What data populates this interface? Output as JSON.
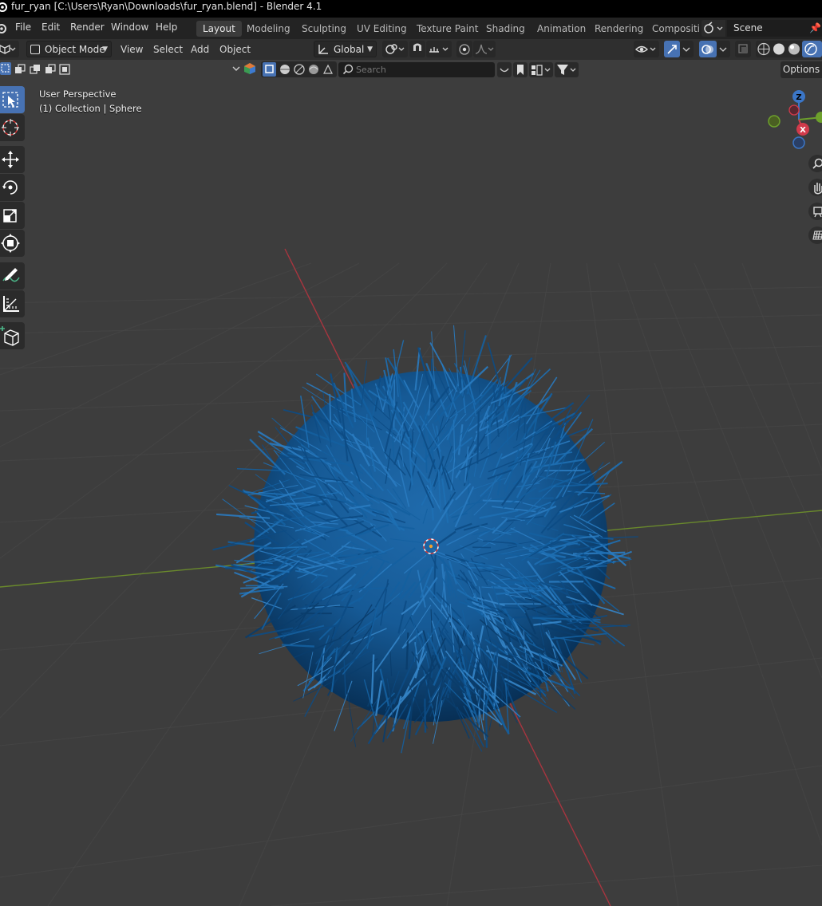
{
  "window": {
    "title": "fur_ryan [C:\\Users\\Ryan\\Downloads\\fur_ryan.blend] - Blender 4.1"
  },
  "menu": {
    "items": [
      "File",
      "Edit",
      "Render",
      "Window",
      "Help"
    ]
  },
  "workspaces": {
    "tabs": [
      "Layout",
      "Modeling",
      "Sculpting",
      "UV Editing",
      "Texture Paint",
      "Shading",
      "Animation",
      "Rendering",
      "Compositi"
    ],
    "active": "Layout"
  },
  "scene": {
    "name": "Scene"
  },
  "header": {
    "mode": "Object Mode",
    "menus": [
      "View",
      "Select",
      "Add",
      "Object"
    ],
    "orientation": "Global"
  },
  "filter_bar": {
    "search_placeholder": "Search",
    "options_label": "Options"
  },
  "viewport": {
    "view_name": "User Perspective",
    "context": "(1) Collection | Sphere",
    "object_color": "#1a5fa0",
    "x_axis_color": "#a8353f",
    "y_axis_color": "#6a8a2c"
  },
  "gizmo": {
    "z_label": "Z",
    "x_label": "X"
  },
  "toolbar": {
    "tools": [
      "select-box",
      "cursor",
      "move",
      "rotate",
      "scale",
      "transform",
      "annotate",
      "measure",
      "add-cube"
    ],
    "active_tool": "select-box"
  },
  "colors": {
    "accent": "#4772b3",
    "background": "#3d3d3d",
    "header": "#2f2f2f"
  }
}
